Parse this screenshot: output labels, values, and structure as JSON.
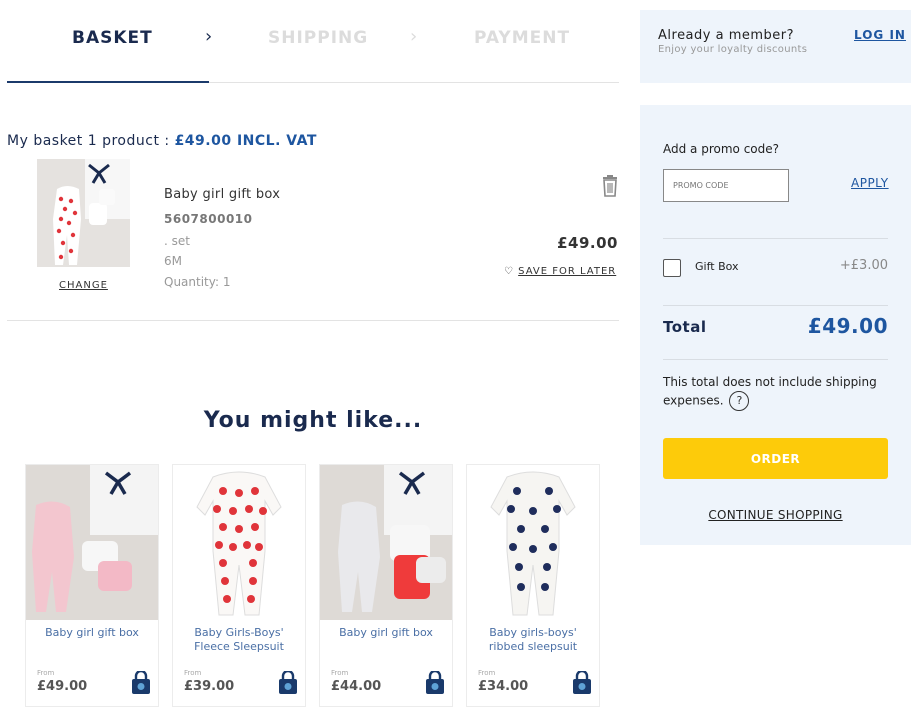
{
  "steps": {
    "basket": "BASKET",
    "shipping": "SHIPPING",
    "payment": "PAYMENT"
  },
  "basket": {
    "title_prefix": "My basket 1 product : ",
    "title_total": "£49.00 INCL. VAT",
    "item": {
      "name": "Baby girl gift box",
      "ref": "5607800010",
      "set": ". set",
      "size": "6M",
      "quantity": "Quantity: 1",
      "price": "£49.00",
      "change": "CHANGE",
      "save_for_later": "SAVE FOR LATER"
    }
  },
  "recommendations": {
    "title": "You might like...",
    "from_label": "From",
    "products": [
      {
        "name": "Baby girl gift box",
        "price": "£49.00"
      },
      {
        "name": "Baby Girls-Boys' Fleece Sleepsuit",
        "price": "£39.00"
      },
      {
        "name": "Baby girl gift box",
        "price": "£44.00"
      },
      {
        "name": "Baby girls-boys' ribbed sleepsuit",
        "price": "£34.00"
      }
    ]
  },
  "member": {
    "question": "Already a member?",
    "subtitle": "Enjoy your loyalty discounts",
    "login": "LOG IN"
  },
  "summary": {
    "promo_label": "Add a promo code?",
    "promo_placeholder": "PROMO CODE",
    "apply": "APPLY",
    "gift_label": "Gift Box",
    "gift_price": "+£3.00",
    "total_label": "Total",
    "total_value": "£49.00",
    "note": "This total does not include shipping expenses.",
    "help": "?",
    "order": "ORDER",
    "continue": "CONTINUE SHOPPING"
  },
  "colors": {
    "navy": "#1a2a4e",
    "accent_blue": "#1e56a0",
    "sidebar_bg": "#eef4fb",
    "order_yellow": "#fdcb0a",
    "heart_red": "#e0343a"
  },
  "icons": [
    "chevron-right-icon",
    "trash-icon",
    "heart-outline-icon",
    "shopping-bag-icon",
    "help-circle-icon",
    "checkbox-icon"
  ]
}
